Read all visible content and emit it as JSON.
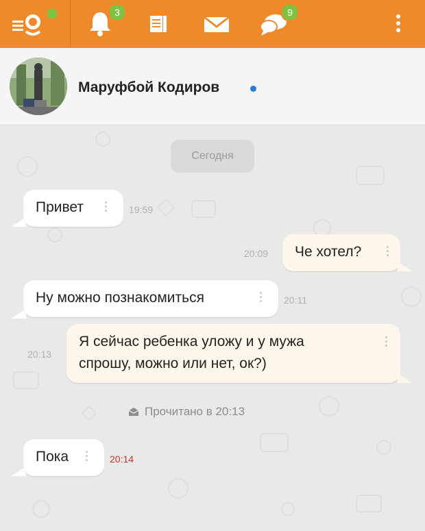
{
  "topbar": {
    "notifications_badge": "3",
    "messages_badge": "9",
    "accent_color": "#ef8a2b",
    "badge_color": "#7fc241",
    "icons": [
      "ok-logo-icon",
      "bell-icon",
      "feed-icon",
      "mail-icon",
      "discussions-icon",
      "more-vert-icon"
    ]
  },
  "header": {
    "contact_name": "Маруфбой Кодиров"
  },
  "chat": {
    "date_label": "Сегодня",
    "messages": [
      {
        "direction": "in",
        "text": "Привет",
        "time": "19:59"
      },
      {
        "direction": "out",
        "text": "Че хотел?",
        "time": "20:09"
      },
      {
        "direction": "in",
        "text": "Ну можно познакомиться",
        "time": "20:11"
      },
      {
        "direction": "out",
        "text_line1": "Я сейчас ребенка уложу и у мужа",
        "text_line2": "спрошу, можно или нет, ок?)",
        "time": "20:13"
      },
      {
        "direction": "in",
        "text": "Пока",
        "time": "20:14"
      }
    ],
    "read_status": "Прочитано в 20:13"
  }
}
